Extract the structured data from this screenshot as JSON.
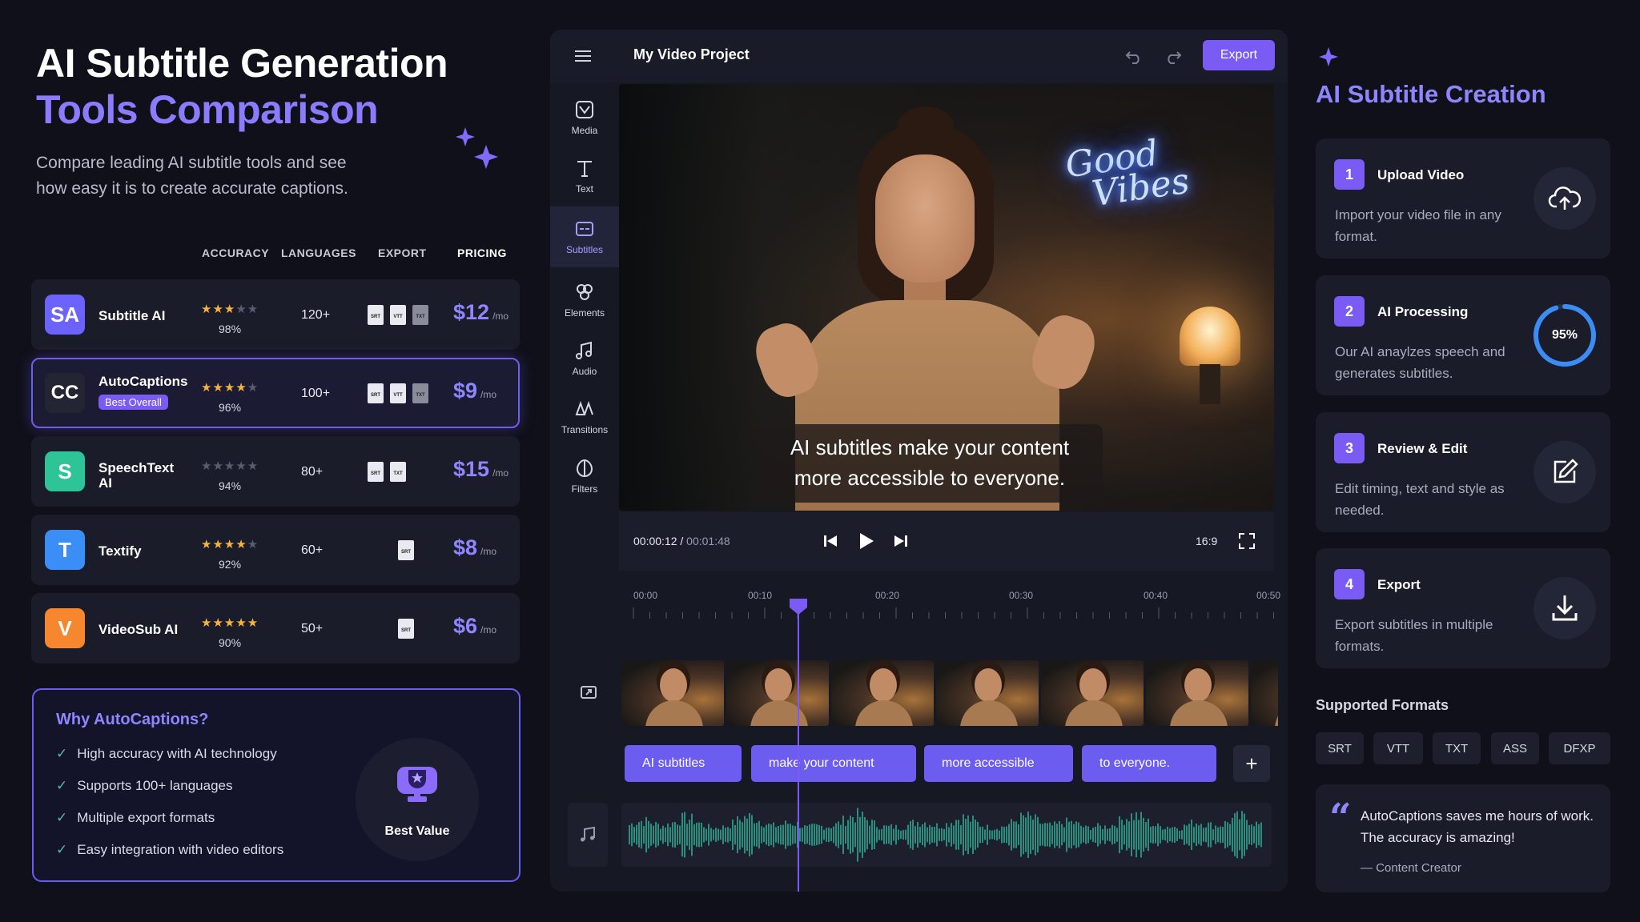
{
  "hero": {
    "title_line1": "AI Subtitle Generation",
    "title_line2": "Tools Comparison",
    "subtitle": "Compare leading AI subtitle tools and see how easy it is to create accurate captions."
  },
  "table": {
    "headers": [
      "ACCURACY",
      "LANGUAGES",
      "EXPORT",
      "PRICING"
    ],
    "rows": [
      {
        "logo": "SA",
        "logo_color": "#6c63ff",
        "name": "Subtitle AI",
        "badge": "",
        "stars": "★★★",
        "stars_off": "★★",
        "accuracy": "98%",
        "languages": "120+",
        "formats": [
          "SRT",
          "VTT",
          "TXT"
        ],
        "price": "$12",
        "unit": "/mo"
      },
      {
        "logo": "CC",
        "logo_color": "#232533",
        "name": "AutoCaptions",
        "badge": "Best Overall",
        "stars": "★★★★",
        "stars_off": "★",
        "accuracy": "96%",
        "languages": "100+",
        "formats": [
          "SRT",
          "VTT",
          "TXT"
        ],
        "price": "$9",
        "unit": "/mo"
      },
      {
        "logo": "S",
        "logo_color": "#2fc497",
        "name": "SpeechText AI",
        "badge": "",
        "stars": "",
        "stars_off": "★★★★★",
        "accuracy": "94%",
        "languages": "80+",
        "formats": [
          "SRT",
          "TXT"
        ],
        "price": "$15",
        "unit": "/mo"
      },
      {
        "logo": "T",
        "logo_color": "#3a8ef6",
        "name": "Textify",
        "badge": "",
        "stars": "★★★★",
        "stars_off": "★",
        "accuracy": "92%",
        "languages": "60+",
        "formats": [
          "SRT"
        ],
        "price": "$8",
        "unit": "/mo"
      },
      {
        "logo": "V",
        "logo_color": "#f7872e",
        "name": "VideoSub AI",
        "badge": "",
        "stars": "★★★★★",
        "stars_off": "",
        "accuracy": "90%",
        "languages": "50+",
        "formats": [
          "SRT"
        ],
        "price": "$6",
        "unit": "/mo"
      }
    ]
  },
  "why": {
    "title": "Why AutoCaptions?",
    "items": [
      "High accuracy with AI technology",
      "Supports 100+ languages",
      "Multiple export formats",
      "Easy integration with video editors"
    ],
    "badge_label": "Best Value"
  },
  "editor": {
    "project_title": "My Video Project",
    "export_label": "Export",
    "sidebar": [
      {
        "label": "Media",
        "icon": "media-icon"
      },
      {
        "label": "Text",
        "icon": "text-icon"
      },
      {
        "label": "Subtitles",
        "icon": "subtitles-icon"
      },
      {
        "label": "Elements",
        "icon": "elements-icon"
      },
      {
        "label": "Audio",
        "icon": "audio-icon"
      },
      {
        "label": "Transitions",
        "icon": "transitions-icon"
      },
      {
        "label": "Filters",
        "icon": "filters-icon"
      }
    ],
    "active_sidebar": "Subtitles",
    "neon_sign_line1": "Good",
    "neon_sign_line2": "Vibes",
    "caption_line1": "AI subtitles make your content",
    "caption_line2": "more accessible to everyone.",
    "time_current": "00:00:12",
    "time_total": "00:01:48",
    "aspect_ratio": "16:9",
    "ruler": [
      "00:00",
      "00:10",
      "00:20",
      "00:30",
      "00:40",
      "00:50"
    ],
    "subtitle_chips": [
      "AI subtitles",
      "make your content",
      "more accessible",
      "to everyone."
    ],
    "add_label": "+"
  },
  "steps_panel": {
    "title": "AI Subtitle Creation",
    "steps": [
      {
        "num": "1",
        "title": "Upload Video",
        "desc": "Import your video file in any format.",
        "icon": "cloud-upload-icon"
      },
      {
        "num": "2",
        "title": "AI Processing",
        "desc": "Our AI anaylzes speech and generates subtitles.",
        "icon": "progress-ring",
        "progress": "95%"
      },
      {
        "num": "3",
        "title": "Review & Edit",
        "desc": "Edit timing, text and style as needed.",
        "icon": "edit-icon"
      },
      {
        "num": "4",
        "title": "Export",
        "desc": "Export subtitles in multiple formats.",
        "icon": "download-icon"
      }
    ],
    "formats_title": "Supported Formats",
    "formats": [
      "SRT",
      "VTT",
      "TXT",
      "ASS",
      "DFXP"
    ],
    "quote": "AutoCaptions saves me hours of work. The accuracy is amazing!",
    "quote_author": "— Content Creator"
  },
  "colors": {
    "accent": "#7a5cf5",
    "accent_text": "#8f86ff",
    "star": "#f5b33d",
    "check": "#5fb6a1",
    "background": "#0f1019"
  }
}
